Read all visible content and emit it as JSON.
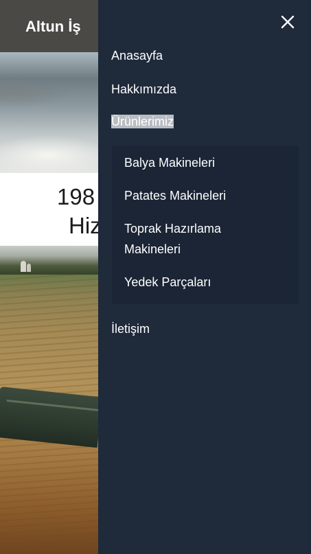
{
  "header": {
    "brand": "Altun İş"
  },
  "hero": {
    "line1": "198",
    "line2": "Hiz"
  },
  "drawer": {
    "close_icon": "close-icon",
    "items": [
      {
        "label": "Anasayfa"
      },
      {
        "label": "Hakkımızda"
      },
      {
        "label": "Ürünlerimiz",
        "active": true
      },
      {
        "label": "İletişim"
      }
    ],
    "submenu": [
      {
        "label": "Balya Makineleri"
      },
      {
        "label": "Patates Makineleri"
      },
      {
        "label": "Toprak Hazırlama Makineleri"
      },
      {
        "label": "Yedek Parçaları"
      }
    ]
  },
  "colors": {
    "drawer_bg": "#1f2a3b",
    "submenu_bg": "#1b2535",
    "active_highlight": "#b9bdc2",
    "topbar_bg": "#4a4946"
  }
}
